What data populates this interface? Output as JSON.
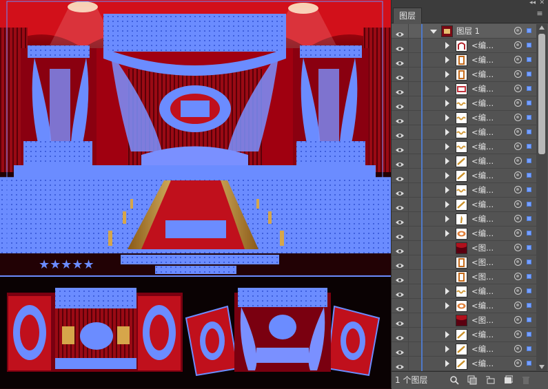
{
  "panel": {
    "tab_label": "图层",
    "layer_count": "1 个图层",
    "collapse_glyph": "◂◂",
    "close_glyph": "✕",
    "menu_glyph": "≡"
  },
  "layers": [
    {
      "name": "图层 1",
      "kind": "parent",
      "expanded": true,
      "thumb": "stage"
    },
    {
      "name": "<编...",
      "kind": "group",
      "thumb": "arch"
    },
    {
      "name": "<编...",
      "kind": "group",
      "thumb": "frame"
    },
    {
      "name": "<编...",
      "kind": "group",
      "thumb": "frame"
    },
    {
      "name": "<编...",
      "kind": "group",
      "thumb": "box"
    },
    {
      "name": "<编...",
      "kind": "group",
      "thumb": "lace"
    },
    {
      "name": "<编...",
      "kind": "group",
      "thumb": "lace"
    },
    {
      "name": "<编...",
      "kind": "group",
      "thumb": "lace"
    },
    {
      "name": "<编...",
      "kind": "group",
      "thumb": "lace"
    },
    {
      "name": "<编...",
      "kind": "group",
      "thumb": "diag"
    },
    {
      "name": "<编...",
      "kind": "group",
      "thumb": "diag"
    },
    {
      "name": "<编...",
      "kind": "group",
      "thumb": "lace"
    },
    {
      "name": "<编...",
      "kind": "group",
      "thumb": "diag"
    },
    {
      "name": "<编...",
      "kind": "group",
      "thumb": "figure"
    },
    {
      "name": "<编...",
      "kind": "group",
      "thumb": "oval"
    },
    {
      "name": "<图...",
      "kind": "image",
      "thumb": "curtain"
    },
    {
      "name": "<图...",
      "kind": "image",
      "thumb": "frame"
    },
    {
      "name": "<图...",
      "kind": "image",
      "thumb": "frame"
    },
    {
      "name": "<编...",
      "kind": "group",
      "thumb": "lace"
    },
    {
      "name": "<编...",
      "kind": "group",
      "thumb": "oval"
    },
    {
      "name": "<图...",
      "kind": "image",
      "thumb": "curtain"
    },
    {
      "name": "<编...",
      "kind": "group",
      "thumb": "diag"
    },
    {
      "name": "<编...",
      "kind": "group",
      "thumb": "diag"
    },
    {
      "name": "<编...",
      "kind": "group",
      "thumb": "diag"
    }
  ],
  "colors": {
    "selection": "#6b8cff",
    "stage_red": "#c0101c",
    "carpet_gold": "#d6a64a",
    "panel_bg": "#535353"
  },
  "icons": {
    "footer": [
      "search-icon",
      "clip-mask-icon",
      "new-sublayer-icon",
      "new-layer-icon",
      "delete-icon"
    ]
  }
}
